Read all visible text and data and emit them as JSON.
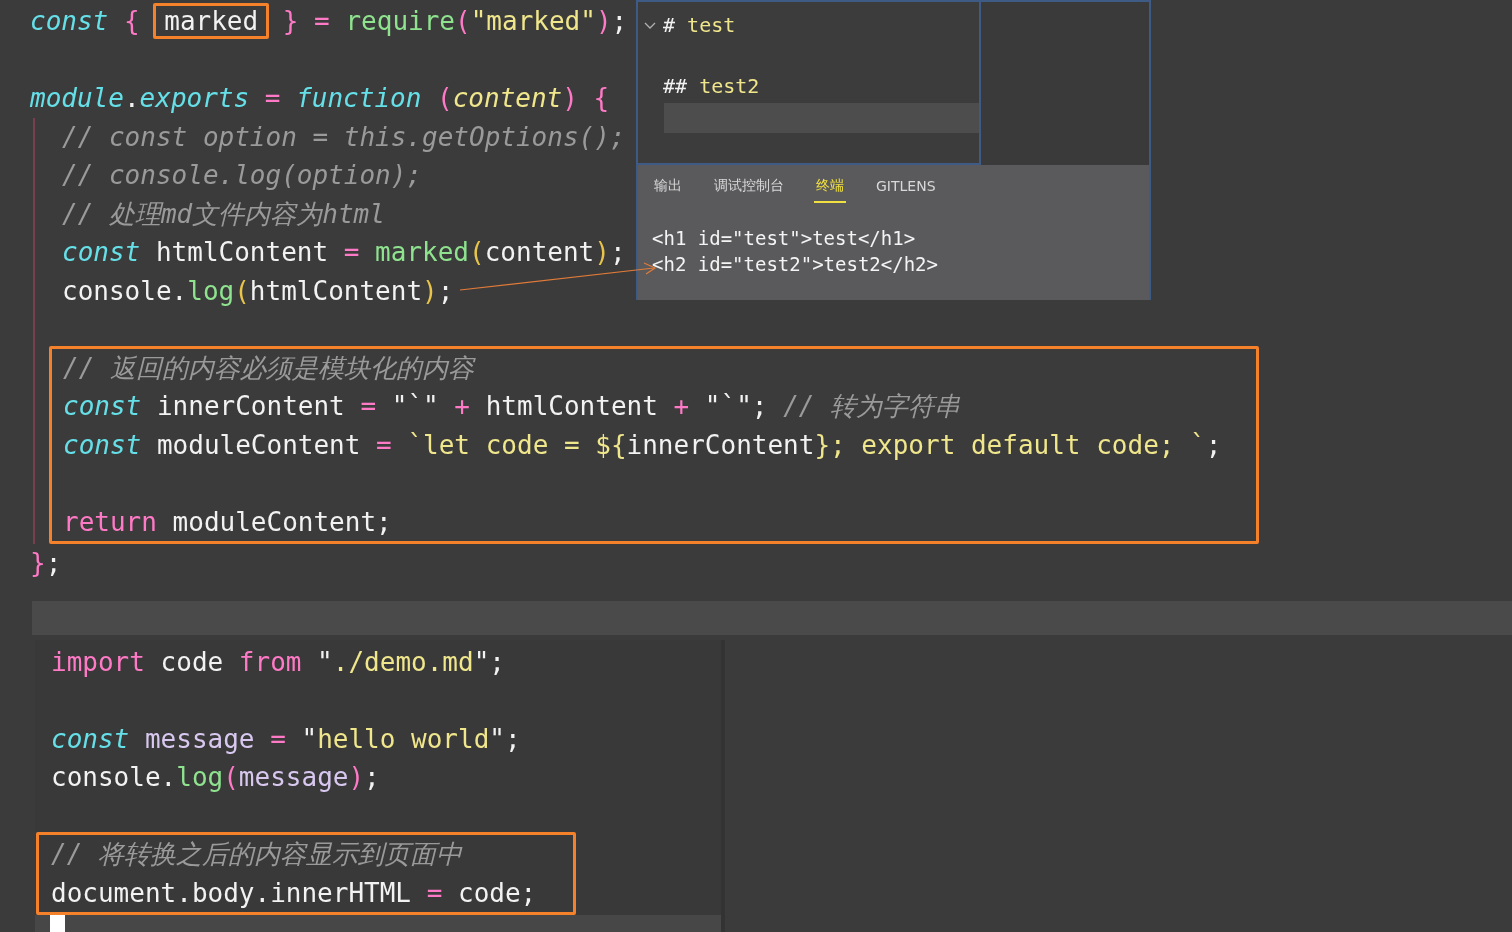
{
  "editor_top": {
    "lines": [
      {
        "tokens": [
          {
            "text": "const ",
            "kind": "keyword"
          },
          {
            "text": "{ ",
            "kind": "bracket"
          },
          {
            "text": "marked",
            "kind": "plain",
            "boxed": true
          },
          {
            "text": " }",
            "kind": "bracket"
          },
          {
            "text": " = ",
            "kind": "operator"
          },
          {
            "text": "require",
            "kind": "function"
          },
          {
            "text": "(",
            "kind": "bracket"
          },
          {
            "text": "\"marked\"",
            "kind": "string"
          },
          {
            "text": ")",
            "kind": "bracket"
          },
          {
            "text": ";",
            "kind": "plain"
          }
        ]
      },
      {
        "kind": "blank"
      },
      {
        "tokens": [
          {
            "text": "module",
            "kind": "keyword"
          },
          {
            "text": ".",
            "kind": "plain"
          },
          {
            "text": "exports",
            "kind": "keyword"
          },
          {
            "text": " = ",
            "kind": "operator"
          },
          {
            "text": "function ",
            "kind": "keyword"
          },
          {
            "text": "(",
            "kind": "bracket"
          },
          {
            "text": "content",
            "kind": "param"
          },
          {
            "text": ")",
            "kind": "bracket"
          },
          {
            "text": " {",
            "kind": "bracket"
          }
        ],
        "children": [
          {
            "boxed": false,
            "lines": [
              {
                "tokens": [
                  {
                    "text": "// const option = this.getOptions();",
                    "kind": "comment"
                  }
                ]
              },
              {
                "tokens": [
                  {
                    "text": "// console.log(option);",
                    "kind": "comment"
                  }
                ]
              },
              {
                "tokens": [
                  {
                    "text": "// 处理md文件内容为html",
                    "kind": "comment"
                  }
                ]
              },
              {
                "tokens": [
                  {
                    "text": "const",
                    "kind": "keyword"
                  },
                  {
                    "text": " htmlContent",
                    "kind": "plain"
                  },
                  {
                    "text": " = ",
                    "kind": "operator"
                  },
                  {
                    "text": "marked",
                    "kind": "function"
                  },
                  {
                    "text": "(",
                    "kind": "paren"
                  },
                  {
                    "text": "content",
                    "kind": "plain"
                  },
                  {
                    "text": ")",
                    "kind": "paren"
                  },
                  {
                    "text": ";",
                    "kind": "plain"
                  }
                ]
              },
              {
                "tokens": [
                  {
                    "text": "console.",
                    "kind": "plain"
                  },
                  {
                    "text": "log",
                    "kind": "function"
                  },
                  {
                    "text": "(",
                    "kind": "paren"
                  },
                  {
                    "text": "htmlContent",
                    "kind": "plain"
                  },
                  {
                    "text": ")",
                    "kind": "paren"
                  },
                  {
                    "text": ";",
                    "kind": "plain"
                  }
                ]
              },
              {
                "kind": "blank"
              }
            ]
          },
          {
            "boxed": true,
            "lines": [
              {
                "tokens": [
                  {
                    "text": "// 返回的内容必须是模块化的内容",
                    "kind": "comment"
                  }
                ]
              },
              {
                "tokens": [
                  {
                    "text": "const",
                    "kind": "keyword"
                  },
                  {
                    "text": " innerContent",
                    "kind": "plain"
                  },
                  {
                    "text": " = ",
                    "kind": "operator"
                  },
                  {
                    "text": "\"`\"",
                    "kind": "plain"
                  },
                  {
                    "text": " + ",
                    "kind": "operator"
                  },
                  {
                    "text": "htmlContent",
                    "kind": "plain"
                  },
                  {
                    "text": " + ",
                    "kind": "operator"
                  },
                  {
                    "text": "\"`\"",
                    "kind": "plain"
                  },
                  {
                    "text": "; ",
                    "kind": "plain"
                  },
                  {
                    "text": "// 转为字符串",
                    "kind": "comment"
                  }
                ]
              },
              {
                "tokens": [
                  {
                    "text": "const",
                    "kind": "keyword"
                  },
                  {
                    "text": " moduleContent",
                    "kind": "plain"
                  },
                  {
                    "text": " = ",
                    "kind": "operator"
                  },
                  {
                    "text": "`let code = ${",
                    "kind": "string"
                  },
                  {
                    "text": "innerContent",
                    "kind": "plain"
                  },
                  {
                    "text": "}; export default code; `",
                    "kind": "string"
                  },
                  {
                    "text": ";",
                    "kind": "plain"
                  }
                ]
              },
              {
                "kind": "blank"
              },
              {
                "tokens": [
                  {
                    "text": "return",
                    "kind": "control"
                  },
                  {
                    "text": " moduleContent;",
                    "kind": "plain"
                  }
                ]
              }
            ]
          }
        ]
      },
      {
        "tokens": [
          {
            "text": "}",
            "kind": "bracket"
          },
          {
            "text": ";",
            "kind": "plain"
          }
        ]
      }
    ]
  },
  "preview_panel": {
    "markdown_lines": [
      {
        "expanded": true,
        "tokens": [
          {
            "text": "# ",
            "kind": "plain"
          },
          {
            "text": "test",
            "kind": "string"
          }
        ]
      },
      {
        "tokens": [
          {
            "text": "## ",
            "kind": "plain"
          },
          {
            "text": "test2",
            "kind": "string"
          }
        ]
      }
    ],
    "tabs": [
      {
        "label": "输出",
        "selected": false
      },
      {
        "label": "调试控制台",
        "selected": false
      },
      {
        "label": "终端",
        "selected": true
      },
      {
        "label": "GITLENS",
        "selected": false
      }
    ],
    "output_lines": [
      "<h1 id=\"test\">test</h1>",
      "<h2 id=\"test2\">test2</h2>"
    ]
  },
  "editor_bottom": {
    "segments": [
      {
        "boxed": false,
        "lines": [
          {
            "tokens": [
              {
                "text": "import",
                "kind": "control"
              },
              {
                "text": " code ",
                "kind": "plain"
              },
              {
                "text": "from",
                "kind": "control"
              },
              {
                "text": " \"",
                "kind": "plain"
              },
              {
                "text": "./demo.md",
                "kind": "string"
              },
              {
                "text": "\";",
                "kind": "plain"
              }
            ]
          },
          {
            "kind": "blank"
          },
          {
            "tokens": [
              {
                "text": "const",
                "kind": "keyword"
              },
              {
                "text": " message",
                "kind": "variable"
              },
              {
                "text": " = ",
                "kind": "operator"
              },
              {
                "text": "\"",
                "kind": "plain"
              },
              {
                "text": "hello world",
                "kind": "string"
              },
              {
                "text": "\";",
                "kind": "plain"
              }
            ]
          },
          {
            "tokens": [
              {
                "text": "console.",
                "kind": "plain"
              },
              {
                "text": "log",
                "kind": "function"
              },
              {
                "text": "(",
                "kind": "bracket"
              },
              {
                "text": "message",
                "kind": "variable"
              },
              {
                "text": ")",
                "kind": "bracket"
              },
              {
                "text": ";",
                "kind": "plain"
              }
            ]
          },
          {
            "kind": "blank"
          }
        ]
      },
      {
        "boxed": true,
        "lines": [
          {
            "tokens": [
              {
                "text": "// 将转换之后的内容显示到页面中",
                "kind": "comment"
              }
            ]
          },
          {
            "tokens": [
              {
                "text": "document.body.innerHTML",
                "kind": "plain"
              },
              {
                "text": " = ",
                "kind": "operator"
              },
              {
                "text": "code;",
                "kind": "plain"
              }
            ]
          }
        ]
      }
    ]
  }
}
